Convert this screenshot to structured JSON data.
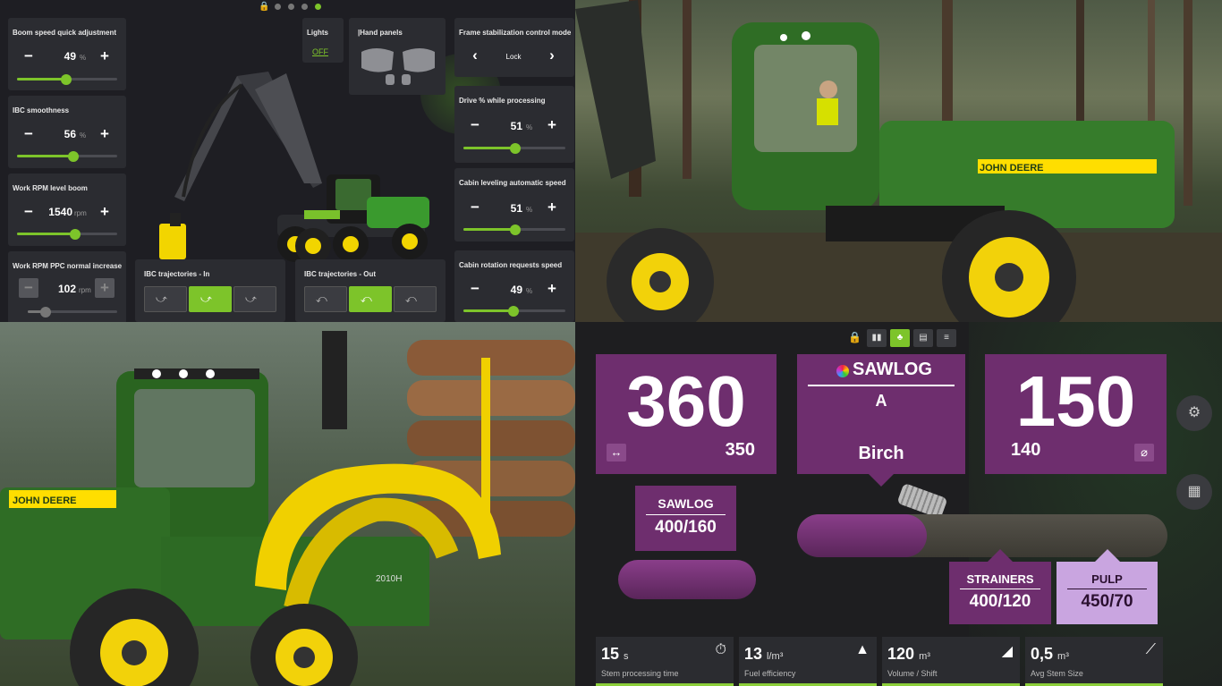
{
  "settings": {
    "boom_speed": {
      "title": "Boom speed quick adjustment",
      "value": "49",
      "unit": "%",
      "level": 0.49
    },
    "ibc_smoothness": {
      "title": "IBC smoothness",
      "value": "56",
      "unit": "%",
      "level": 0.56
    },
    "work_rpm_boom": {
      "title": "Work RPM level boom",
      "value": "1540",
      "unit": "rpm",
      "level": 0.58
    },
    "work_rpm_ppc": {
      "title": "Work RPM PPC normal increase",
      "value": "102",
      "unit": "rpm",
      "level": 0.2
    },
    "lights": {
      "title": "Lights",
      "state": "OFF"
    },
    "hand_panels": {
      "title": "|Hand panels"
    },
    "frame_stabilization": {
      "title": "Frame stabilization control mode",
      "value": "Lock"
    },
    "drive_processing": {
      "title": "Drive % while processing",
      "value": "51",
      "unit": "%",
      "level": 0.51
    },
    "cabin_leveling": {
      "title": "Cabin leveling automatic speed",
      "value": "51",
      "unit": "%",
      "level": 0.51
    },
    "cabin_rotation": {
      "title": "Cabin rotation requests speed",
      "value": "49",
      "unit": "%",
      "level": 0.49
    },
    "ibc_in": {
      "title": "IBC trajectories - In",
      "selected": 1
    },
    "ibc_out": {
      "title": "IBC trajectories - Out",
      "selected": 1
    },
    "pager": {
      "count": 4,
      "active": 3
    },
    "minus": "−",
    "plus": "+",
    "prev": "‹",
    "next": "›"
  },
  "harvester_photo": {
    "brand": "JOHN DEERE"
  },
  "forwarder_photo": {
    "brand": "JOHN DEERE",
    "model": "2010H"
  },
  "measurement": {
    "toolbar": {
      "icons": [
        "lock-icon",
        "bar-chart-icon",
        "tree-icon",
        "map-icon",
        "sliders-icon"
      ],
      "active": 2
    },
    "length": {
      "value": "360",
      "target": "350"
    },
    "assortment": {
      "title": "SAWLOG",
      "grade": "A",
      "species": "Birch"
    },
    "diameter": {
      "value": "150",
      "target": "140"
    },
    "prev_log": {
      "label": "SAWLOG",
      "dims": "400/160"
    },
    "strainers": {
      "label": "STRAINERS",
      "dims": "400/120"
    },
    "pulp": {
      "label": "PULP",
      "dims": "450/70"
    },
    "log_progress": 0.2,
    "stats": [
      {
        "num": "15",
        "unit": "s",
        "label": "Stem processing time"
      },
      {
        "num": "13",
        "unit": "l/m³",
        "label": "Fuel efficiency"
      },
      {
        "num": "120",
        "unit": "m³",
        "label": "Volume / Shift"
      },
      {
        "num": "0,5",
        "unit": "m³",
        "label": "Avg Stem Size"
      }
    ]
  },
  "colors": {
    "accent": "#7dc42a",
    "purple": "#6e2e6e",
    "light_purple": "#c9a5e0",
    "deere_green": "#367c2b",
    "deere_yellow": "#ffde00"
  }
}
